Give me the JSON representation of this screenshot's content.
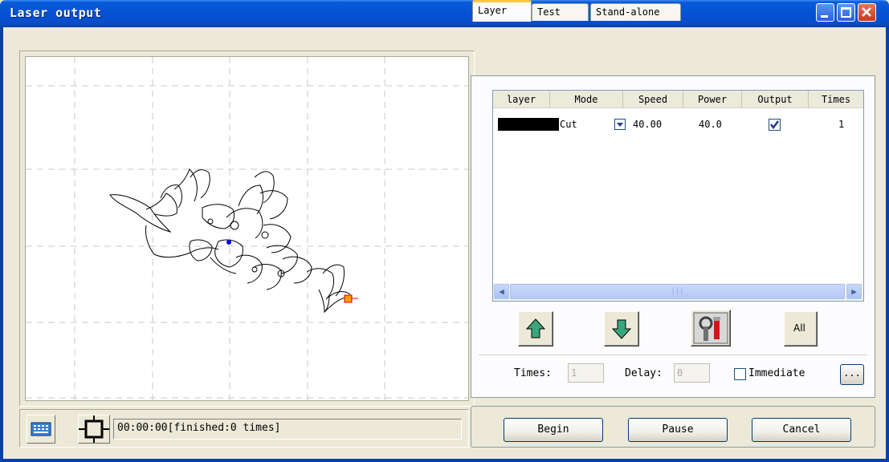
{
  "window": {
    "title": "Laser output"
  },
  "status": {
    "text": "00:00:00[finished:0 times]"
  },
  "tabs": [
    {
      "label": "Layer",
      "active": true
    },
    {
      "label": "Test",
      "active": false
    },
    {
      "label": "Stand-alone",
      "active": false
    }
  ],
  "layer_table": {
    "columns": [
      "layer",
      "Mode",
      "Speed",
      "Power",
      "Output",
      "Times"
    ],
    "rows": [
      {
        "layer_color": "#000000",
        "mode": "Cut",
        "speed": "40.00",
        "power": "40.0",
        "output": true,
        "times": "1"
      }
    ]
  },
  "layer_actions": {
    "all_label": "All"
  },
  "output_options": {
    "times_label": "Times:",
    "times_value": "1",
    "delay_label": "Delay:",
    "delay_value": "0",
    "immediate_label": "Immediate",
    "immediate_checked": false,
    "more_label": "..."
  },
  "controls": {
    "begin": "Begin",
    "pause": "Pause",
    "cancel": "Cancel"
  },
  "colors": {
    "title_bar": "#0553d6",
    "accent_tab": "#ffc83c",
    "start_marker": "#0000ff",
    "end_marker": "#ff0000"
  }
}
